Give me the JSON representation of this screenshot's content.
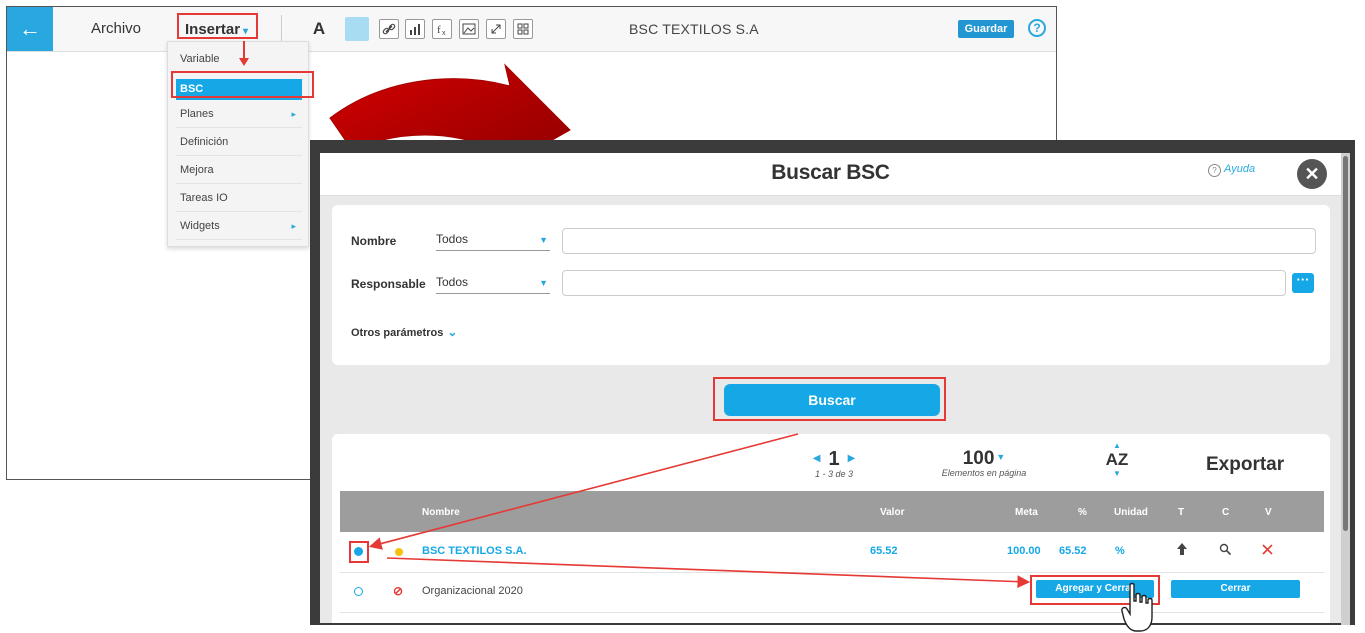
{
  "topbar": {
    "back_label": "←",
    "archivo": "Archivo",
    "insertar": "Insertar",
    "insertar_caret": "▾",
    "doc_title": "BSC TEXTILOS S.A",
    "save": "Guardar",
    "help": "?",
    "text_tool": "A"
  },
  "dropdown": {
    "items": [
      "Variable",
      "BSC",
      "Planes",
      "Definición",
      "Mejora",
      "Tareas IO",
      "Widgets"
    ],
    "submenu_glyph": "▸"
  },
  "dialog": {
    "title": "Buscar BSC",
    "ayuda": "Ayuda",
    "close": "✕",
    "filters": {
      "nombre_label": "Nombre",
      "nombre_value": "Todos",
      "responsable_label": "Responsable",
      "responsable_value": "Todos",
      "dots": "···",
      "otros": "Otros parámetros"
    },
    "buscar": "Buscar",
    "pager": {
      "page": "1",
      "range": "1 - 3 de 3",
      "per_page": "100",
      "per_page_label": "Elementos en página"
    },
    "az": "AZ",
    "exportar": "Exportar",
    "columns": {
      "nombre": "Nombre",
      "valor": "Valor",
      "meta": "Meta",
      "pct": "%",
      "unidad": "Unidad",
      "t": "T",
      "c": "C",
      "v": "V"
    },
    "rows": [
      {
        "name": "BSC TEXTILOS S.A.",
        "valor": "65.52",
        "meta": "100.00",
        "pct": "65.52",
        "unidad": "%"
      },
      {
        "name": "Organizacional 2020",
        "btn_add": "Agregar y Cerrar",
        "btn_close": "Cerrar"
      }
    ]
  },
  "colors": {
    "accent": "#16a8e6",
    "highlight": "#e53935",
    "dark_red_arrow": "#c00000"
  }
}
